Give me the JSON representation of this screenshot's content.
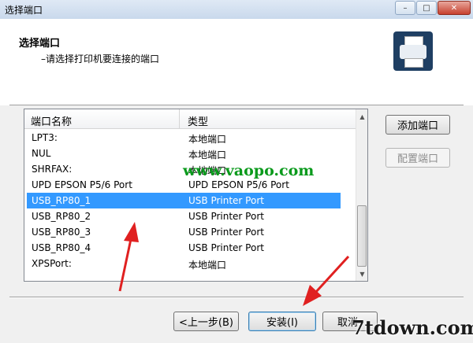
{
  "window": {
    "title": "选择端口",
    "controls": {
      "minimize": "–",
      "maximize": "□",
      "close": "✕"
    }
  },
  "header": {
    "title": "选择端口",
    "subtitle": "–请选择打印机要连接的端口",
    "icon": "printer-icon"
  },
  "port_list": {
    "columns": [
      "端口名称",
      "类型"
    ],
    "rows": [
      {
        "name": "LPT3:",
        "type": "本地端口",
        "selected": false
      },
      {
        "name": "NUL",
        "type": "本地端口",
        "selected": false
      },
      {
        "name": "SHRFAX:",
        "type": "本地端口",
        "selected": false
      },
      {
        "name": "UPD EPSON P5/6 Port",
        "type": "UPD EPSON P5/6 Port",
        "selected": false
      },
      {
        "name": "USB_RP80_1",
        "type": "USB Printer Port",
        "selected": true
      },
      {
        "name": "USB_RP80_2",
        "type": "USB Printer Port",
        "selected": false
      },
      {
        "name": "USB_RP80_3",
        "type": "USB Printer Port",
        "selected": false
      },
      {
        "name": "USB_RP80_4",
        "type": "USB Printer Port",
        "selected": false
      },
      {
        "name": "XPSPort:",
        "type": "本地端口",
        "selected": false
      }
    ],
    "selection_color": "#3399ff"
  },
  "side_buttons": {
    "add_port": "添加端口",
    "configure_port": "配置端口"
  },
  "footer_buttons": {
    "back": "<上一步(B)",
    "install": "安装(I)",
    "cancel": "取消"
  },
  "watermarks": {
    "center": "www.vaopo.com",
    "corner": "7tdown.com"
  },
  "annotation_color": "#e02020"
}
